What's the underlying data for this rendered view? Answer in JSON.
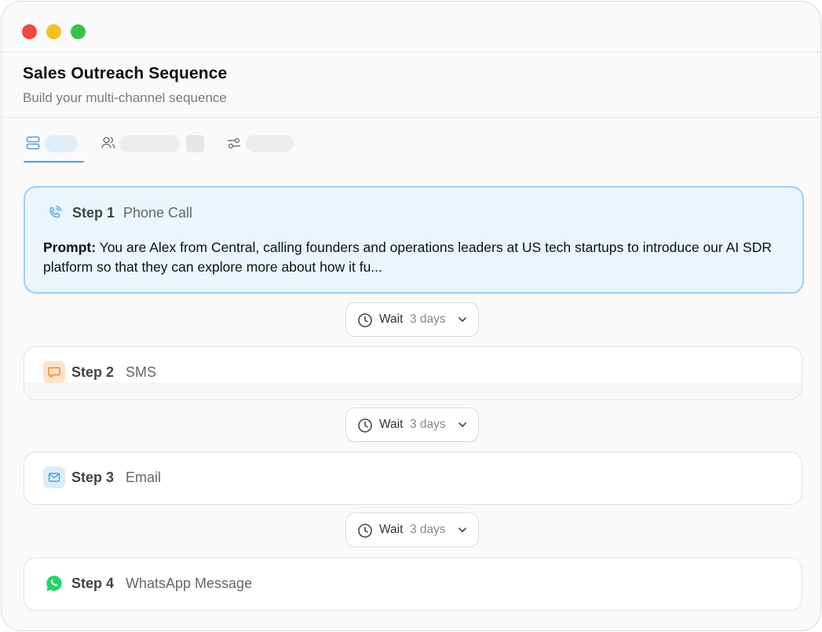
{
  "window": {
    "title": "Sales Outreach Sequence",
    "subtitle": "Build your multi-channel sequence"
  },
  "tabs": [
    {
      "icon": "sequence-list-icon",
      "active": true
    },
    {
      "icon": "users-icon",
      "active": false
    },
    {
      "icon": "settings-sliders-icon",
      "active": false
    }
  ],
  "steps": [
    {
      "number": "Step 1",
      "type": "Phone Call",
      "icon": "phone-call-icon",
      "prompt_label": "Prompt:",
      "prompt_text": "You are Alex from Central, calling founders and operations leaders at US tech startups to introduce our AI SDR platform so that they can explore more about how it fu..."
    },
    {
      "number": "Step 2",
      "type": "SMS",
      "icon": "sms-chat-icon"
    },
    {
      "number": "Step 3",
      "type": "Email",
      "icon": "email-envelope-icon"
    },
    {
      "number": "Step 4",
      "type": "WhatsApp Message",
      "icon": "whatsapp-icon"
    }
  ],
  "waits": [
    {
      "label": "Wait",
      "value": "3 days"
    },
    {
      "label": "Wait",
      "value": "3 days"
    },
    {
      "label": "Wait",
      "value": "3 days"
    }
  ],
  "colors": {
    "accent": "#4ba3e3",
    "active_card_bg": "#eaf5fe",
    "sms_orange": "#f08a2a",
    "whatsapp_green": "#25d366"
  }
}
